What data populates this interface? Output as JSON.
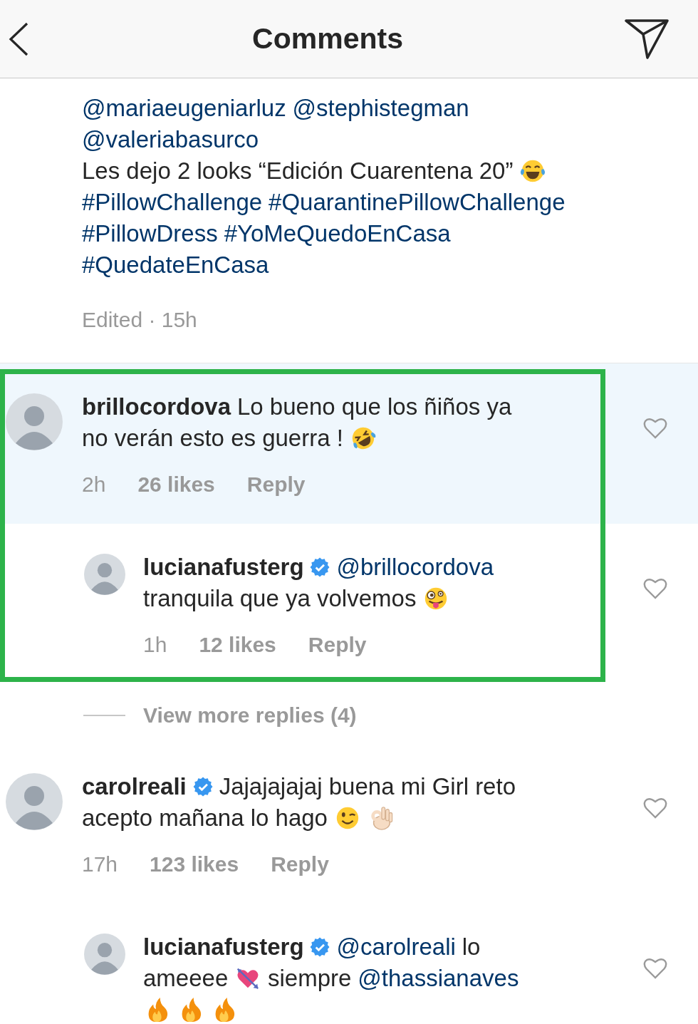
{
  "header": {
    "title": "Comments"
  },
  "caption": {
    "lines": [
      [
        {
          "kind": "mention",
          "text": "@mariaeugeniarluz"
        },
        {
          "kind": "mention",
          "text": "@stephistegman"
        }
      ],
      [
        {
          "kind": "mention",
          "text": "@valeriabasurco"
        }
      ],
      [
        {
          "kind": "text",
          "text": "Les dejo 2 looks “Edición Cuarentena 20”"
        },
        {
          "kind": "joy"
        }
      ],
      [
        {
          "kind": "hashtag",
          "text": "#PillowChallenge"
        },
        {
          "kind": "hashtag",
          "text": "#QuarantinePillowChallenge"
        }
      ],
      [
        {
          "kind": "hashtag",
          "text": "#PillowDress"
        },
        {
          "kind": "hashtag",
          "text": "#YoMeQuedoEnCasa"
        }
      ],
      [
        {
          "kind": "hashtag",
          "text": "#QuedateEnCasa"
        }
      ]
    ],
    "meta": "Edited · 15h"
  },
  "comments": [
    {
      "username": "brillocordova",
      "verified": false,
      "highlighted": true,
      "framed": true,
      "liked": false,
      "lines": [
        [
          {
            "kind": "text",
            "text": "Lo bueno que los ñiños ya"
          }
        ],
        [
          {
            "kind": "text",
            "text": "no verán esto es guerra !"
          },
          {
            "kind": "rofl"
          }
        ]
      ],
      "time": "2h",
      "likes": "26 likes",
      "reply": "Reply",
      "replies": [
        {
          "username": "lucianafusterg",
          "verified": true,
          "liked": false,
          "lines": [
            [
              {
                "kind": "mention",
                "text": "@brillocordova"
              }
            ],
            [
              {
                "kind": "text",
                "text": "tranquila que ya volvemos"
              },
              {
                "kind": "zany"
              }
            ]
          ],
          "time": "1h",
          "likes": "12 likes",
          "reply": "Reply"
        }
      ],
      "view_more": "View more replies (4)"
    },
    {
      "username": "carolreali",
      "verified": true,
      "highlighted": false,
      "framed": false,
      "liked": false,
      "lines": [
        [
          {
            "kind": "text",
            "text": "Jajajajajaj buena mi Girl reto"
          }
        ],
        [
          {
            "kind": "text",
            "text": "acepto mañana lo hago"
          },
          {
            "kind": "wink"
          },
          {
            "kind": "ok-hand"
          }
        ]
      ],
      "time": "17h",
      "likes": "123 likes",
      "reply": "Reply",
      "replies": [
        {
          "username": "lucianafusterg",
          "verified": true,
          "liked": false,
          "lines": [
            [
              {
                "kind": "mention",
                "text": "@carolreali"
              },
              {
                "kind": "text",
                "text": "lo"
              }
            ],
            [
              {
                "kind": "text",
                "text": "ameeee"
              },
              {
                "kind": "heart-arrow"
              },
              {
                "kind": "text",
                "text": "siempre"
              },
              {
                "kind": "mention",
                "text": "@thassianaves"
              }
            ],
            [
              {
                "kind": "fire"
              },
              {
                "kind": "fire"
              },
              {
                "kind": "fire"
              }
            ]
          ]
        }
      ]
    }
  ]
}
